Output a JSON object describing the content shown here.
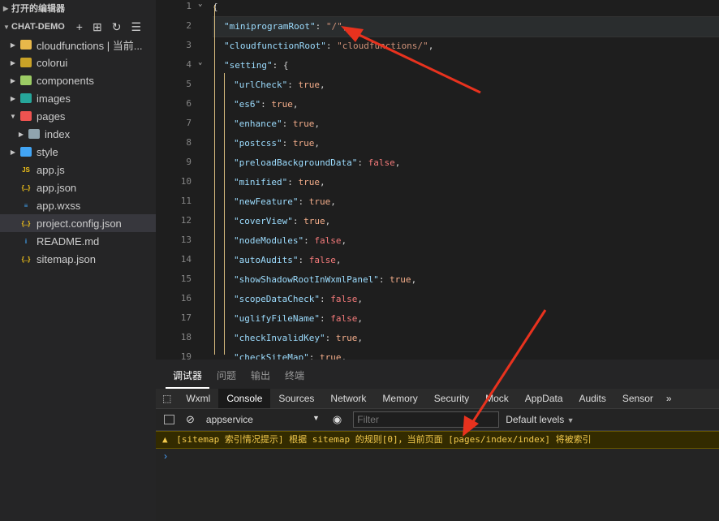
{
  "sidebar": {
    "open_editors": "打开的编辑器",
    "project": "CHAT-DEMO",
    "files": [
      {
        "label": "cloudfunctions | 当前...",
        "icon": "folder-cloud-icon",
        "color": "#e8b84a",
        "expandable": true,
        "depth": 0
      },
      {
        "label": "colorui",
        "icon": "folder-icon",
        "color": "#c9a227",
        "expandable": true,
        "depth": 0
      },
      {
        "label": "components",
        "icon": "folder-components-icon",
        "color": "#9ccc65",
        "expandable": true,
        "depth": 0
      },
      {
        "label": "images",
        "icon": "folder-images-icon",
        "color": "#26a69a",
        "expandable": true,
        "depth": 0
      },
      {
        "label": "pages",
        "icon": "folder-pages-icon",
        "color": "#ef5350",
        "expandable": true,
        "expanded": true,
        "depth": 0
      },
      {
        "label": "index",
        "icon": "folder-icon",
        "color": "#90a4ae",
        "expandable": true,
        "depth": 1
      },
      {
        "label": "style",
        "icon": "folder-style-icon",
        "color": "#42a5f5",
        "expandable": true,
        "depth": 0
      },
      {
        "label": "app.js",
        "icon": "js-file-icon",
        "color": "#f5c518",
        "depth": 0,
        "glyph": "JS"
      },
      {
        "label": "app.json",
        "icon": "json-file-icon",
        "color": "#f5c518",
        "depth": 0,
        "glyph": "{..}"
      },
      {
        "label": "app.wxss",
        "icon": "css-file-icon",
        "color": "#42a5f5",
        "depth": 0,
        "glyph": "≡"
      },
      {
        "label": "project.config.json",
        "icon": "json-file-icon",
        "color": "#f5c518",
        "depth": 0,
        "glyph": "{..}",
        "selected": true
      },
      {
        "label": "README.md",
        "icon": "info-file-icon",
        "color": "#42a5f5",
        "depth": 0,
        "glyph": "i"
      },
      {
        "label": "sitemap.json",
        "icon": "json-file-icon",
        "color": "#f5c518",
        "depth": 0,
        "glyph": "{..}"
      }
    ]
  },
  "editor": {
    "lines": [
      {
        "n": "1",
        "open": "{"
      },
      {
        "n": "2",
        "key": "\"miniprogramRoot\"",
        "val": "\"/\"",
        "vtype": "s",
        "tail": ","
      },
      {
        "n": "3",
        "key": "\"cloudfunctionRoot\"",
        "val": "\"cloudfunctions/\"",
        "vtype": "s",
        "tail": ","
      },
      {
        "n": "4",
        "key": "\"setting\"",
        "val": "{",
        "vtype": "p",
        "tail": ""
      },
      {
        "n": "5",
        "key": "\"urlCheck\"",
        "val": "true",
        "vtype": "t",
        "tail": ","
      },
      {
        "n": "6",
        "key": "\"es6\"",
        "val": "true",
        "vtype": "t",
        "tail": ","
      },
      {
        "n": "7",
        "key": "\"enhance\"",
        "val": "true",
        "vtype": "t",
        "tail": ","
      },
      {
        "n": "8",
        "key": "\"postcss\"",
        "val": "true",
        "vtype": "t",
        "tail": ","
      },
      {
        "n": "9",
        "key": "\"preloadBackgroundData\"",
        "val": "false",
        "vtype": "f",
        "tail": ","
      },
      {
        "n": "10",
        "key": "\"minified\"",
        "val": "true",
        "vtype": "t",
        "tail": ","
      },
      {
        "n": "11",
        "key": "\"newFeature\"",
        "val": "true",
        "vtype": "t",
        "tail": ","
      },
      {
        "n": "12",
        "key": "\"coverView\"",
        "val": "true",
        "vtype": "t",
        "tail": ","
      },
      {
        "n": "13",
        "key": "\"nodeModules\"",
        "val": "false",
        "vtype": "f",
        "tail": ","
      },
      {
        "n": "14",
        "key": "\"autoAudits\"",
        "val": "false",
        "vtype": "f",
        "tail": ","
      },
      {
        "n": "15",
        "key": "\"showShadowRootInWxmlPanel\"",
        "val": "true",
        "vtype": "t",
        "tail": ","
      },
      {
        "n": "16",
        "key": "\"scopeDataCheck\"",
        "val": "false",
        "vtype": "f",
        "tail": ","
      },
      {
        "n": "17",
        "key": "\"uglifyFileName\"",
        "val": "false",
        "vtype": "f",
        "tail": ","
      },
      {
        "n": "18",
        "key": "\"checkInvalidKey\"",
        "val": "true",
        "vtype": "t",
        "tail": ","
      },
      {
        "n": "19",
        "key": "\"checkSiteMap\"",
        "val": "true",
        "vtype": "t",
        "tail": ","
      }
    ]
  },
  "devtools": {
    "tabs": [
      "调试器",
      "问题",
      "输出",
      "终端"
    ],
    "active_tab": "调试器",
    "panel_tabs": [
      "Wxml",
      "Console",
      "Sources",
      "Network",
      "Memory",
      "Security",
      "Mock",
      "AppData",
      "Audits",
      "Sensor"
    ],
    "active_panel": "Console",
    "more": "»",
    "context": "appservice",
    "filter_placeholder": "Filter",
    "levels": "Default levels",
    "warning": "[sitemap 索引情况提示] 根据 sitemap 的规则[0]，当前页面 [pages/index/index] 将被索引",
    "prompt": "›"
  },
  "colors": {
    "arrow": "#e8321e",
    "warning_bg": "#332b00",
    "warning_text": "#f2c94c"
  }
}
